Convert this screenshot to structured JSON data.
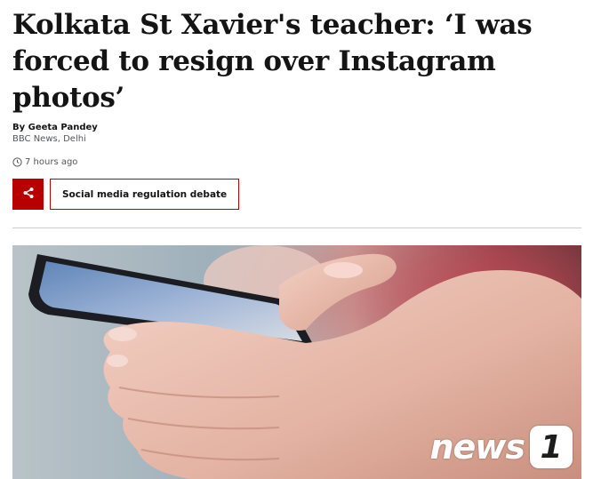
{
  "article": {
    "headline": "Kolkata St Xavier's teacher: ‘I was forced to resign over Instagram photos’",
    "byline": {
      "author": "By Geeta Pandey",
      "organisation": "BBC News, Delhi"
    },
    "timestamp": "7 hours ago",
    "share_icon": "share-icon",
    "topic_tag": "Social media regulation debate",
    "hero_image": {
      "description_icon": "phone-in-hand-photo",
      "watermark_text": "news",
      "watermark_badge": "1"
    }
  },
  "colors": {
    "accent": "#b80000",
    "text": "#141414",
    "muted": "#545658",
    "divider": "#cccccc"
  }
}
